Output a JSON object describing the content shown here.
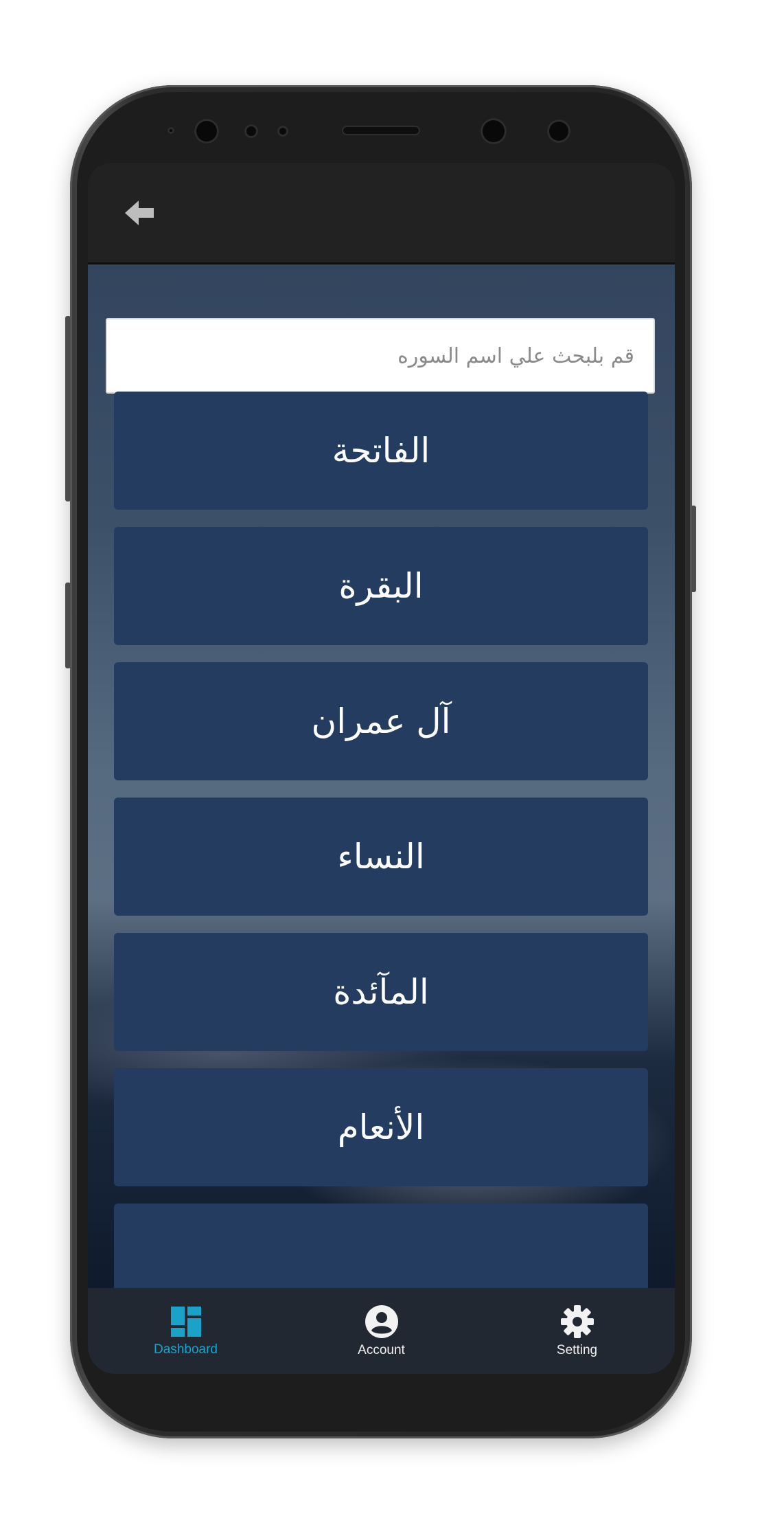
{
  "header": {
    "back_icon": "arrow-left-icon"
  },
  "search": {
    "placeholder": "قم بلبحث علي اسم السوره",
    "value": ""
  },
  "surahs": [
    "الفاتحة",
    "البقرة",
    "آل عمران",
    "النساء",
    "المآئدة",
    "الأنعام"
  ],
  "bottom_nav": {
    "items": [
      {
        "label": "Dashboard",
        "icon": "dashboard-icon",
        "active": true
      },
      {
        "label": "Account",
        "icon": "account-circle-icon",
        "active": false
      },
      {
        "label": "Setting",
        "icon": "gear-icon",
        "active": false
      }
    ]
  },
  "colors": {
    "accent": "#1ba2c9",
    "surah_button": "#243c60",
    "app_bar": "#222222",
    "bottom_nav": "#222831"
  }
}
